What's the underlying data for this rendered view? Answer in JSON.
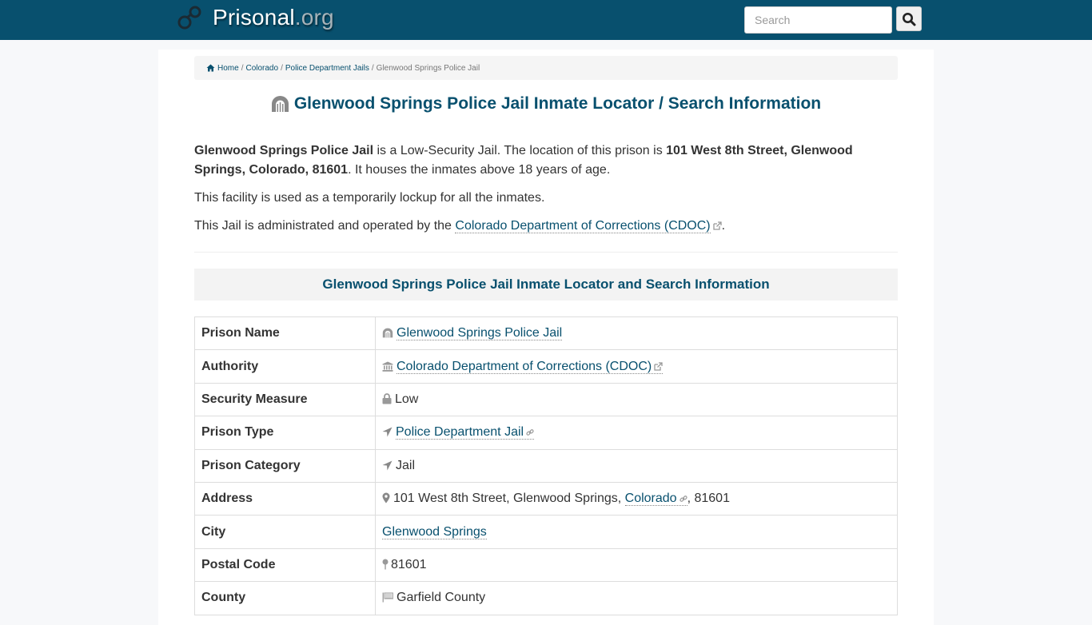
{
  "header": {
    "brand_name": "Prisonal",
    "brand_tld": ".org",
    "search_placeholder": "Search",
    "search_value": ""
  },
  "breadcrumb": {
    "items": [
      "Home",
      "Colorado",
      "Police Department Jails"
    ],
    "current": "Glenwood Springs Police Jail"
  },
  "page": {
    "title": "Glenwood Springs Police Jail Inmate Locator / Search Information",
    "intro": {
      "p1_name": "Glenwood Springs Police Jail",
      "p1_text_a": " is a Low-Security Jail. The location of this prison is ",
      "p1_address": "101 West 8th Street, Glenwood Springs, Colorado, 81601",
      "p1_text_b": ". It houses the inmates above 18 years of age.",
      "p2": "This facility is used as a temporarily lockup for all the inmates.",
      "p3_text": "This Jail is administrated and operated by the ",
      "p3_link": "Colorado Department of Corrections (CDOC)",
      "p3_end": "."
    },
    "section_heading": "Glenwood Springs Police Jail Inmate Locator and Search Information"
  },
  "table": {
    "rows": [
      {
        "label": "Prison Name",
        "value": "Glenwood Springs Police Jail"
      },
      {
        "label": "Authority",
        "value": "Colorado Department of Corrections (CDOC)"
      },
      {
        "label": "Security Measure",
        "value": "Low"
      },
      {
        "label": "Prison Type",
        "value": "Police Department Jail"
      },
      {
        "label": "Prison Category",
        "value": "Jail"
      },
      {
        "label": "Address",
        "value_street": "101 West 8th Street, Glenwood Springs, ",
        "value_state": "Colorado",
        "value_zip": ", 81601"
      },
      {
        "label": "City",
        "value": "Glenwood Springs"
      },
      {
        "label": "Postal Code",
        "value": "81601"
      },
      {
        "label": "County",
        "value": "Garfield County"
      }
    ]
  }
}
